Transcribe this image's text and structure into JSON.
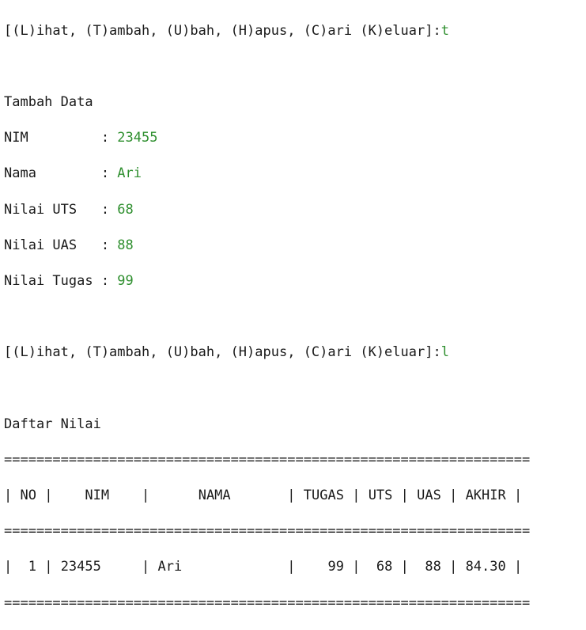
{
  "session": {
    "prompt": "[(L)ihat, (T)ambah, (U)bah, (H)apus, (C)ari (K)eluar]:",
    "first_input": "t",
    "second_input": "l"
  },
  "tambah": {
    "heading": "Tambah Data",
    "fields": [
      {
        "label": "NIM         : ",
        "value": "23455"
      },
      {
        "label": "Nama        : ",
        "value": "Ari"
      },
      {
        "label": "Nilai UTS   : ",
        "value": "68"
      },
      {
        "label": "Nilai UAS   : ",
        "value": "88"
      },
      {
        "label": "Nilai Tugas : ",
        "value": "99"
      }
    ]
  },
  "daftar": {
    "heading": "Daftar Nilai",
    "rule": "=================================================================",
    "header": {
      "no": "NO",
      "nim": "NIM",
      "nama": "NAMA",
      "tugas": "TUGAS",
      "uts": "UTS",
      "uas": "UAS",
      "akhir": "AKHIR"
    },
    "rows": [
      {
        "no": "1",
        "nim": "23455",
        "nama": "Ari",
        "tugas": "99",
        "uts": "68",
        "uas": "88",
        "akhir": "84.30"
      }
    ]
  }
}
